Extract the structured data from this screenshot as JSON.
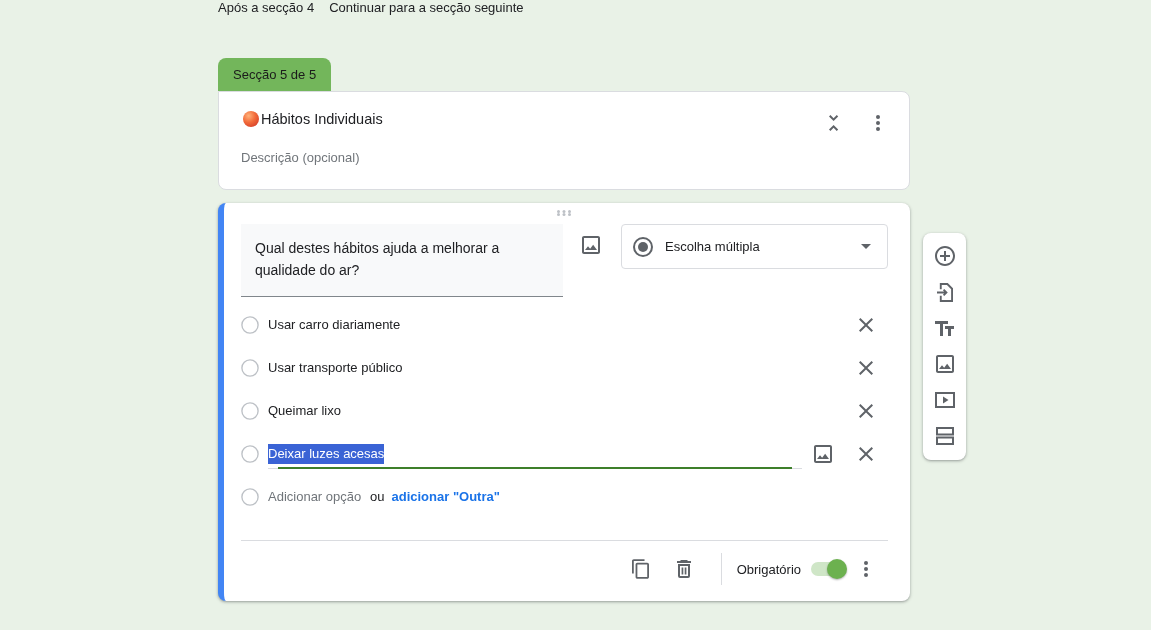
{
  "after_section": {
    "label": "Após a secção 4",
    "action": "Continuar para a secção seguinte"
  },
  "section": {
    "tab": "Secção 5 de 5",
    "title": "Hábitos Individuais",
    "description": {
      "placeholder": "Descrição (opcional)"
    }
  },
  "question": {
    "active": true,
    "title": "Qual destes hábitos ajuda a melhorar a qualidade do ar?",
    "type": "Escolha múltipla",
    "options": [
      {
        "label": "Usar carro diariamente",
        "focused": false
      },
      {
        "label": "Usar transporte público",
        "focused": false
      },
      {
        "label": "Queimar lixo",
        "focused": false
      },
      {
        "label": "Deixar luzes acesas",
        "focused": true
      }
    ],
    "add_option": {
      "placeholder": "Adicionar opção",
      "separator": "ou",
      "link": "adicionar \"Outra\""
    },
    "required_label": "Obrigatório",
    "required": true
  }
}
